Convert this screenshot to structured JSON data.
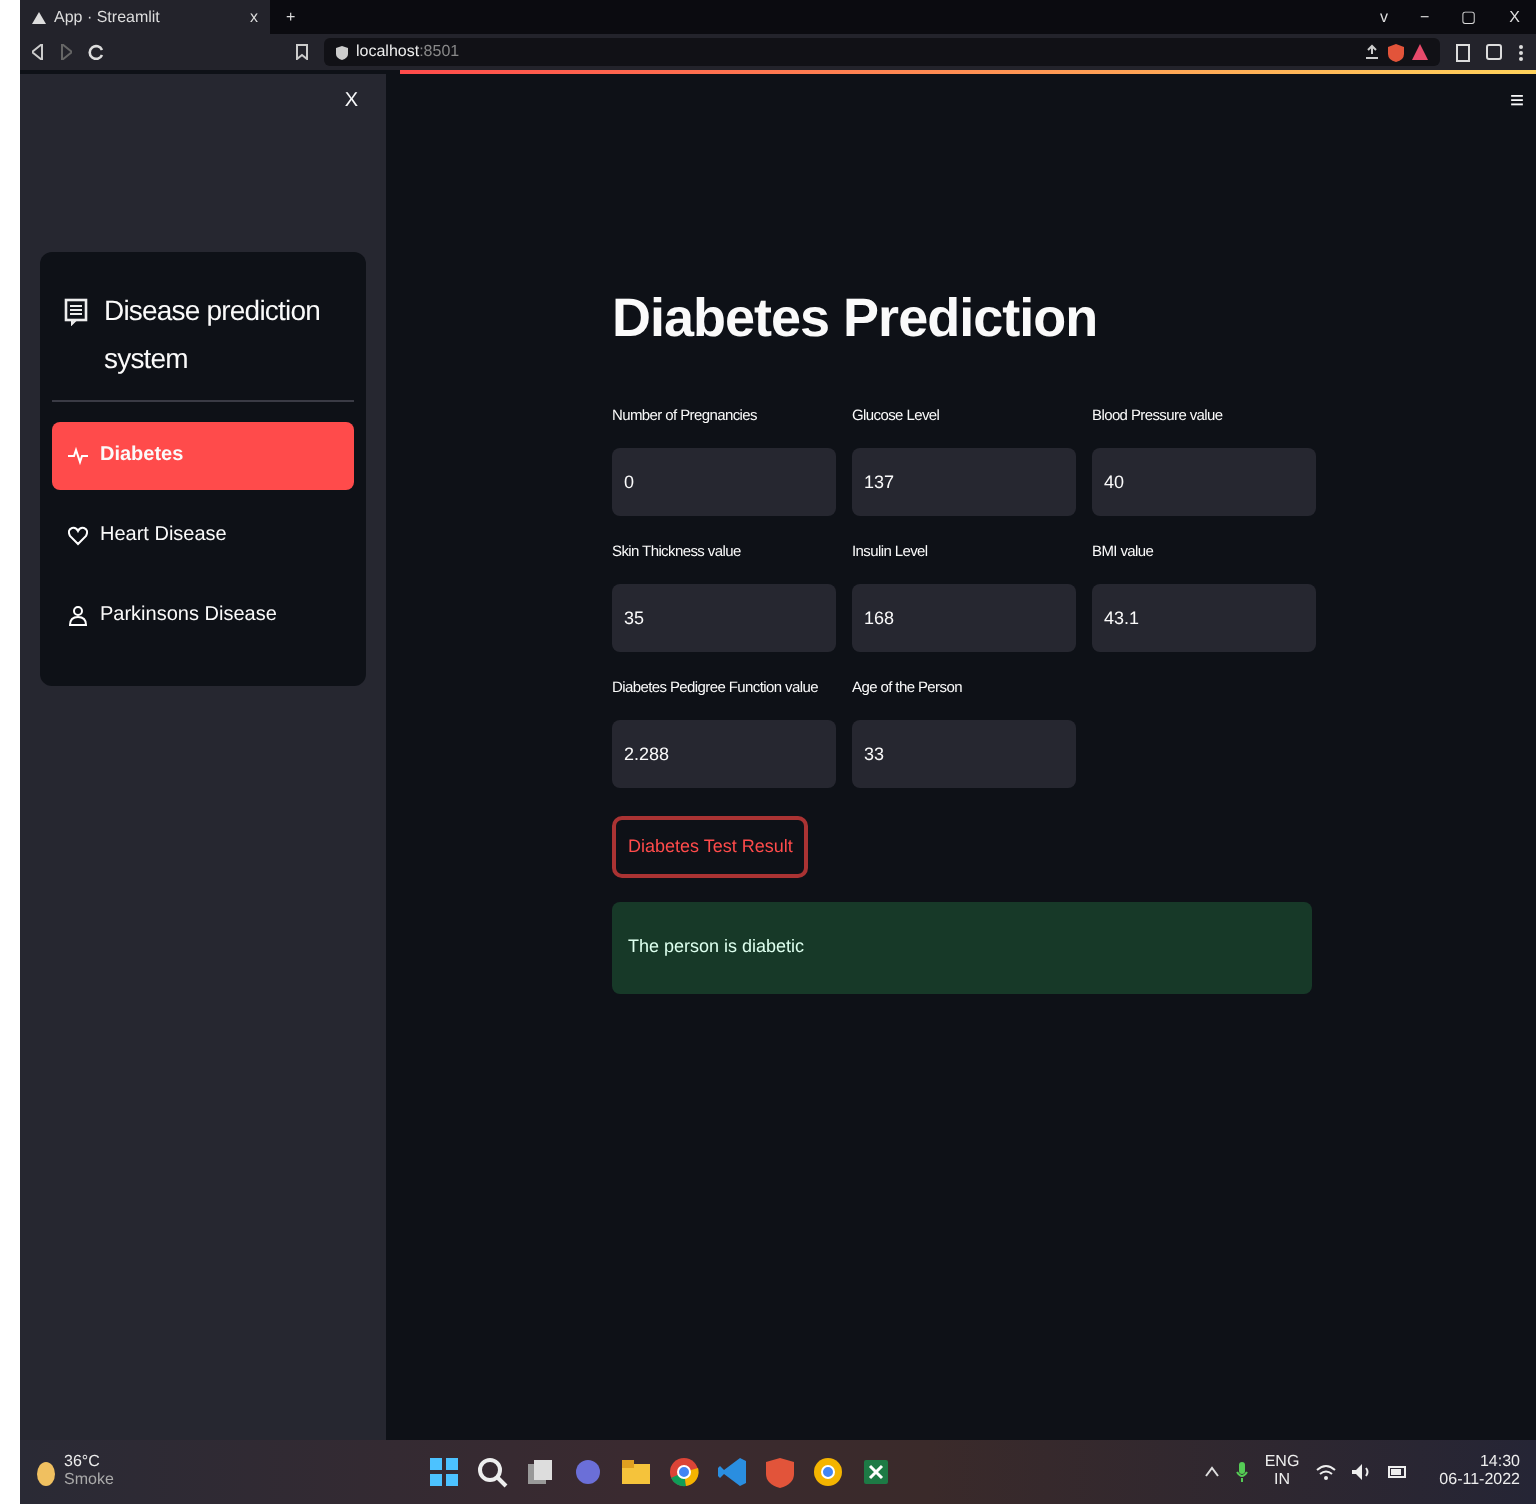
{
  "browser": {
    "tab_title": "App · Streamlit",
    "tab_close": "x",
    "new_tab": "+",
    "url_host": "localhost",
    "url_port": ":8501",
    "window_controls": [
      "v",
      "−",
      "▢",
      "X"
    ]
  },
  "sidebar": {
    "close": "X",
    "title": "Disease prediction system",
    "items": [
      {
        "label": "Diabetes",
        "kind": "pulse",
        "selected": true
      },
      {
        "label": "Heart Disease",
        "kind": "heart",
        "selected": false
      },
      {
        "label": "Parkinsons Disease",
        "kind": "person",
        "selected": false
      }
    ]
  },
  "main": {
    "menu": "≡",
    "title": "Diabetes Prediction",
    "fields": [
      {
        "label": "Number of Pregnancies",
        "value": "0"
      },
      {
        "label": "Glucose Level",
        "value": "137"
      },
      {
        "label": "Blood Pressure value",
        "value": "40"
      },
      {
        "label": "Skin Thickness value",
        "value": "35"
      },
      {
        "label": "Insulin Level",
        "value": "168"
      },
      {
        "label": "BMI value",
        "value": "43.1"
      },
      {
        "label": "Diabetes Pedigree Function value",
        "value": "2.288"
      },
      {
        "label": "Age of the Person",
        "value": "33"
      }
    ],
    "button": "Diabetes Test Result",
    "result": "The person is diabetic"
  },
  "taskbar": {
    "temperature": "36°C",
    "weather": "Smoke",
    "language": "ENG",
    "region": "IN",
    "time": "14:30",
    "date": "06-11-2022"
  }
}
